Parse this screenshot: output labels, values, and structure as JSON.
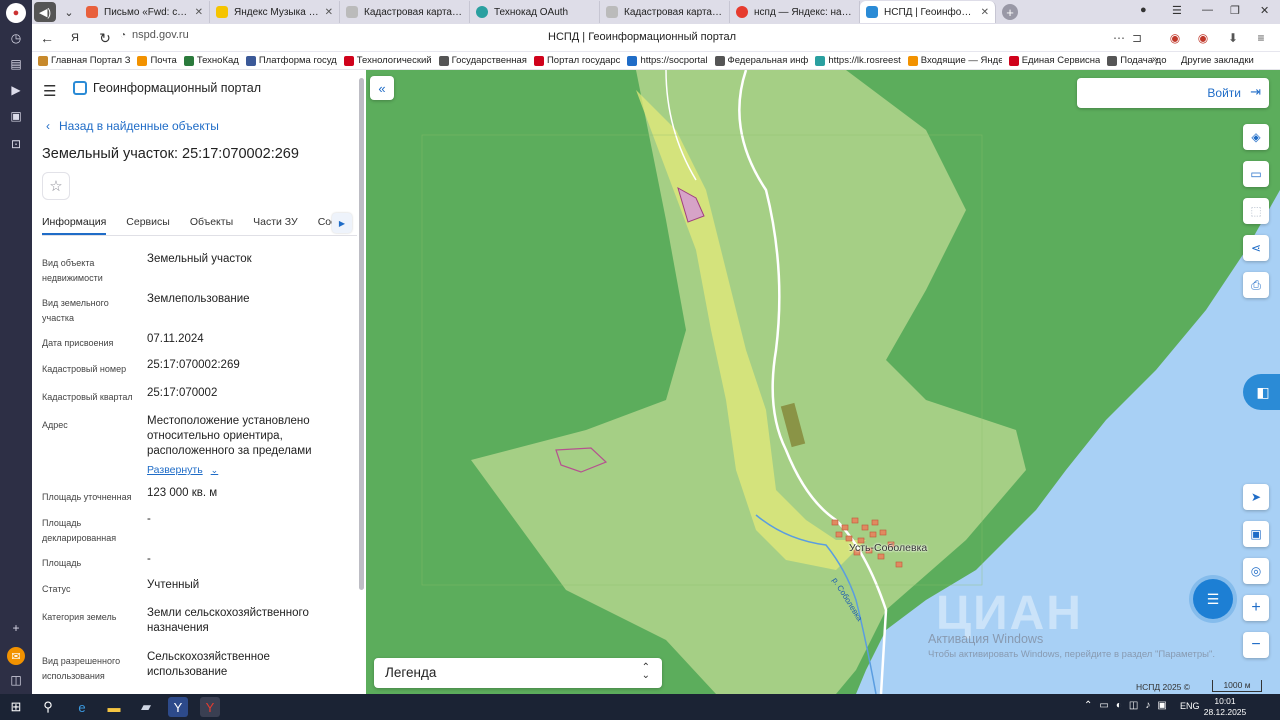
{
  "browser": {
    "tabs": [
      {
        "title": "Письмо «Fwd: счет за дв",
        "color": "#e8603c"
      },
      {
        "title": "Яндекс Музыка — с",
        "color": "#f5c400"
      },
      {
        "title": "Кадастровая карта Сибир",
        "color": "#888"
      },
      {
        "title": "Технокад OAuth",
        "color": "#2aa0a0"
      },
      {
        "title": "Кадастровая карта Сибир",
        "color": "#888"
      },
      {
        "title": "нспд — Яндекс: нашлось",
        "color": "#e63b2e"
      },
      {
        "title": "НСПД | Геоинформаци",
        "color": "#2b8bd6"
      }
    ],
    "url": "nspd.gov.ru",
    "page_title": "НСПД | Геоинформационный портал",
    "bookmarks": [
      {
        "label": "Главная Портал З",
        "color": "#c7892c"
      },
      {
        "label": "Почта",
        "color": "#f29200"
      },
      {
        "label": "ТехноКад",
        "color": "#2b7a3c"
      },
      {
        "label": "Платформа госуд",
        "color": "#3b5998"
      },
      {
        "label": "Технологический",
        "color": "#d0021b"
      },
      {
        "label": "Государственная",
        "color": "#555"
      },
      {
        "label": "Портал государс",
        "color": "#d0021b"
      },
      {
        "label": "https://socportal",
        "color": "#1f6cc7"
      },
      {
        "label": "Федеральная инф",
        "color": "#555"
      },
      {
        "label": "https://lk.rosreest",
        "color": "#2aa0a0"
      },
      {
        "label": "Входящие — Янде",
        "color": "#f29200"
      },
      {
        "label": "Единая Сервисна",
        "color": "#d0021b"
      },
      {
        "label": "Подача до",
        "color": "#555"
      }
    ],
    "bookmarks_more": "»",
    "bookmarks_other": "Другие закладки"
  },
  "panel": {
    "portal_title": "Геоинформационный портал",
    "back_label": "Назад в найденные объекты",
    "object_title": "Земельный участок: 25:17:070002:269",
    "tabs": [
      "Информация",
      "Сервисы",
      "Объекты",
      "Части ЗУ",
      "Соста"
    ],
    "fields": [
      {
        "label": "Вид объекта недвижимости",
        "value": "Земельный участок"
      },
      {
        "label": "Вид земельного участка",
        "value": "Землепользование"
      },
      {
        "label": "Дата присвоения",
        "value": "07.11.2024"
      },
      {
        "label": "Кадастровый номер",
        "value": "25:17:070002:269"
      },
      {
        "label": "Кадастровый квартал",
        "value": "25:17:070002"
      },
      {
        "label": "Адрес",
        "value": "Местоположение установлено относительно ориентира, расположенного за пределами"
      },
      {
        "label": "Площадь уточненная",
        "value": "123 000 кв. м"
      },
      {
        "label": "Площадь декларированная",
        "value": "-"
      },
      {
        "label": "Площадь",
        "value": "-"
      },
      {
        "label": "Статус",
        "value": "Учтенный"
      },
      {
        "label": "Категория земель",
        "value": "Земли сельскохозяйственного назначения"
      },
      {
        "label": "Вид разрешенного использования",
        "value": "Сельскохозяйственное использование"
      }
    ],
    "expand_label": "Развернуть"
  },
  "map": {
    "login_label": "Войти",
    "legend_label": "Легенда",
    "village_label": "Усть-Соболевка",
    "river_label": "р. Соболевка",
    "watermark_title": "Активация Windows",
    "watermark_text": "Чтобы активировать Windows, перейдите в раздел \"Параметры\".",
    "cian_text": "ЦИАН",
    "copyright": "НСПД 2025 ©",
    "scale": "1000 м",
    "colors": {
      "forest": "#5cad5c",
      "field": "#a5cf85",
      "sea": "#a8d0f5",
      "parcel": "#e4e97a",
      "building": "#e08a60"
    }
  },
  "taskbar": {
    "lang": "ENG",
    "time": "10:01",
    "date": "28.12.2025"
  }
}
